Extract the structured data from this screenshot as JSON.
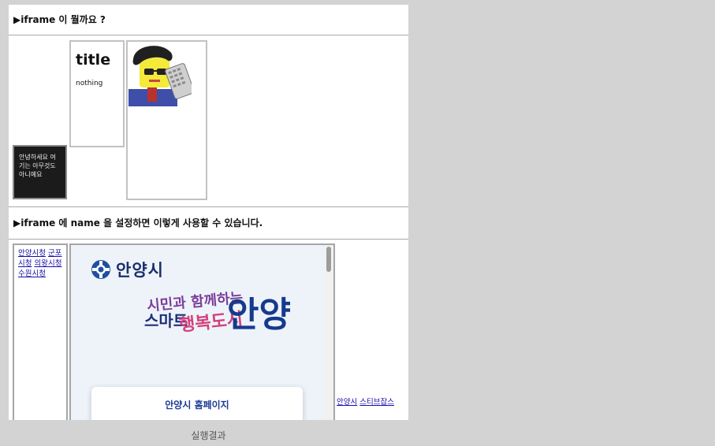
{
  "section1": {
    "heading": "▶iframe 이 뭘까요 ?"
  },
  "dark_box": {
    "text": "안녕하세요 여기는 아무것도 아니예요"
  },
  "title_box": {
    "title": "title",
    "body": "nothing"
  },
  "section2": {
    "heading": "▶iframe 에 name 을 설정하면 이렇게 사용할 수 있습니다."
  },
  "links": [
    {
      "label": "안양시청"
    },
    {
      "label": "군포시청"
    },
    {
      "label": "의왕시청"
    },
    {
      "label": "수원시청"
    }
  ],
  "anyang": {
    "logo": "안양시",
    "slogan_top": "시민과 함께하는",
    "slogan_left": "스마트",
    "slogan_mid": "행복도시",
    "slogan_big": "안양",
    "card": "안양시 홈페이지"
  },
  "right_links": [
    {
      "label": "안양시"
    },
    {
      "label": "스티브잡스"
    }
  ],
  "caption": "실행결과",
  "colors": {
    "link": "#1a0dab",
    "page_bg": "#d3d3d3",
    "anyang_navy": "#163a8c"
  }
}
